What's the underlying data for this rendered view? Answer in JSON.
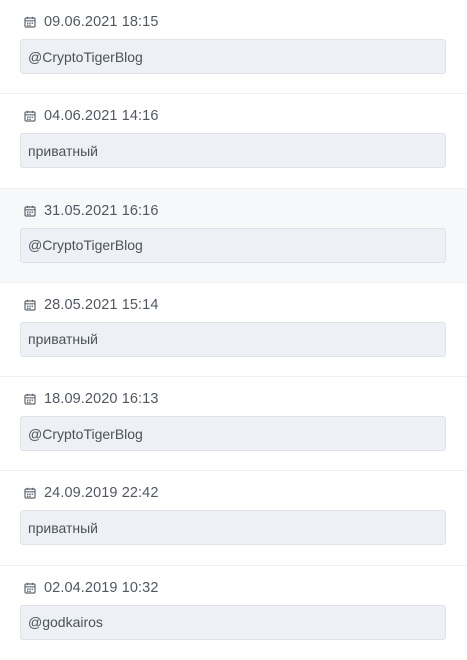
{
  "entries": [
    {
      "date": "09.06.2021 18:15",
      "value": "@CryptoTigerBlog",
      "highlighted": false
    },
    {
      "date": "04.06.2021 14:16",
      "value": "приватный",
      "highlighted": false
    },
    {
      "date": "31.05.2021 16:16",
      "value": "@CryptoTigerBlog",
      "highlighted": true
    },
    {
      "date": "28.05.2021 15:14",
      "value": "приватный",
      "highlighted": false
    },
    {
      "date": "18.09.2020 16:13",
      "value": "@CryptoTigerBlog",
      "highlighted": false
    },
    {
      "date": "24.09.2019 22:42",
      "value": "приватный",
      "highlighted": false
    },
    {
      "date": "02.04.2019 10:32",
      "value": "@godkairos",
      "highlighted": false
    }
  ],
  "icons": {
    "date_icon": "calendar-icon"
  },
  "colors": {
    "highlight_background": "#f6f8fa",
    "value_background": "#edf0f5",
    "value_border": "#dfe3e9",
    "text": "#4c525b"
  }
}
